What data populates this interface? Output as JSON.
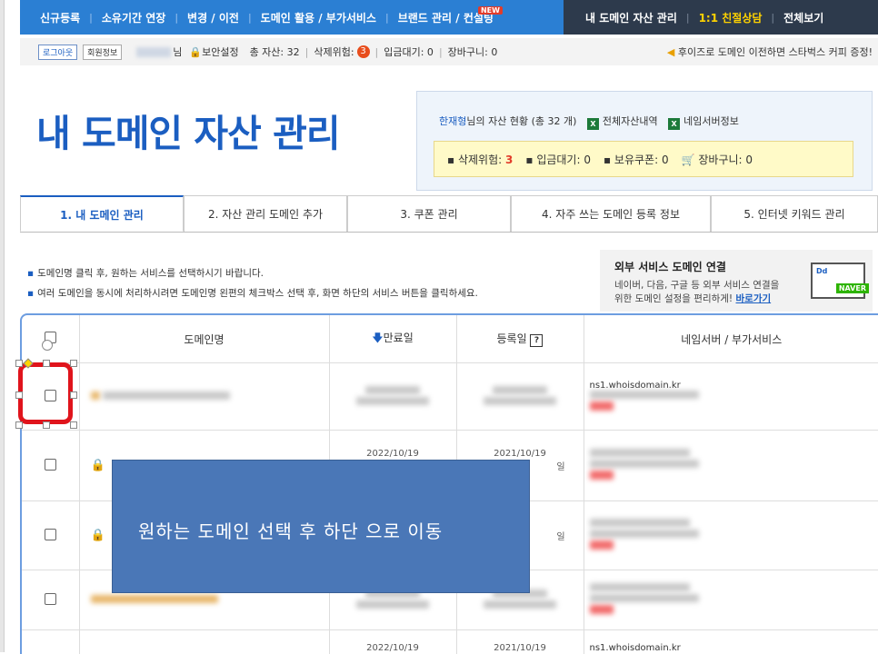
{
  "topnav": {
    "items": [
      "신규등록",
      "소유기간 연장",
      "변경 / 이전",
      "도메인 활용 / 부가서비스",
      "브랜드 관리 / 컨설팅"
    ],
    "new_badge": "NEW",
    "dark_items": [
      "내 도메인 자산 관리",
      "1:1 친절상담",
      "전체보기"
    ],
    "sep": "|"
  },
  "userbar": {
    "logout": "로그아웃",
    "member_info": "회원정보",
    "name_suffix": "님",
    "security": "보안설정",
    "total_assets": "총 자산: 32",
    "delete_risk": "삭제위험:",
    "delete_count": "3",
    "pending": "입금대기: 0",
    "cart": "장바구니: 0",
    "promo": "후이즈로 도메인 이전하면 스타벅스 커피 증정!"
  },
  "page_title": "내 도메인 자산 관리",
  "asset_box": {
    "owner": "한재형",
    "summary": "님의 자산 현황 (총 32 개)",
    "full_list": "전체자산내역",
    "nameserver_info": "네임서버정보",
    "delete_risk_label": "삭제위험:",
    "delete_risk_value": "3",
    "pending": "입금대기: 0",
    "coupons": "보유쿠폰: 0",
    "cart": "장바구니: 0"
  },
  "tabs": [
    "1. 내 도메인 관리",
    "2. 자산 관리 도메인 추가",
    "3. 쿠폰 관리",
    "4. 자주 쓰는 도메인 등록 정보",
    "5. 인터넷 키워드 관리"
  ],
  "notes": [
    "도메인명 클릭 후, 원하는 서비스를 선택하시기 바랍니다.",
    "여러 도메인을 동시에 처리하시려면 도메인명 왼편의 체크박스 선택 후, 화면 하단의 서비스 버튼을 클릭하세요."
  ],
  "ext_service": {
    "title": "외부 서비스 도메인 연결",
    "desc1": "네이버, 다음, 구글 등 외부 서비스 연결을",
    "desc2": "위한 도메인 설정을 편리하게!",
    "link": "바로가기",
    "badge": "NAVER",
    "logo": "Dd"
  },
  "table": {
    "headers": [
      "도메인명",
      "만료일",
      "등록일",
      "네임서버 / 부가서비스"
    ],
    "sort_arrow": "🡇",
    "help": "?",
    "rows": [
      {
        "expire": "",
        "reg": "",
        "ns": "ns1.whoisdomain.kr",
        "suffix": ""
      },
      {
        "expire": "2022/10/19",
        "reg": "2021/10/19",
        "ns": "ns1.whoisdomain.kr",
        "suffix": "일"
      },
      {
        "expire": "",
        "reg": "",
        "ns": "",
        "suffix": "일"
      },
      {
        "expire": "",
        "reg": "",
        "ns": "",
        "suffix": ""
      },
      {
        "expire": "2022/10/19",
        "reg": "2021/10/19",
        "ns": "ns1.whoisdomain.kr",
        "suffix": ""
      }
    ]
  },
  "callout": "원하는 도메인 선택 후 하단 으로 이동",
  "colors": {
    "primary": "#2b7fd3",
    "dark": "#2d3a4c",
    "accent": "#1b5ec1",
    "highlight": "#e0141c",
    "callout": "#4a77b7"
  }
}
